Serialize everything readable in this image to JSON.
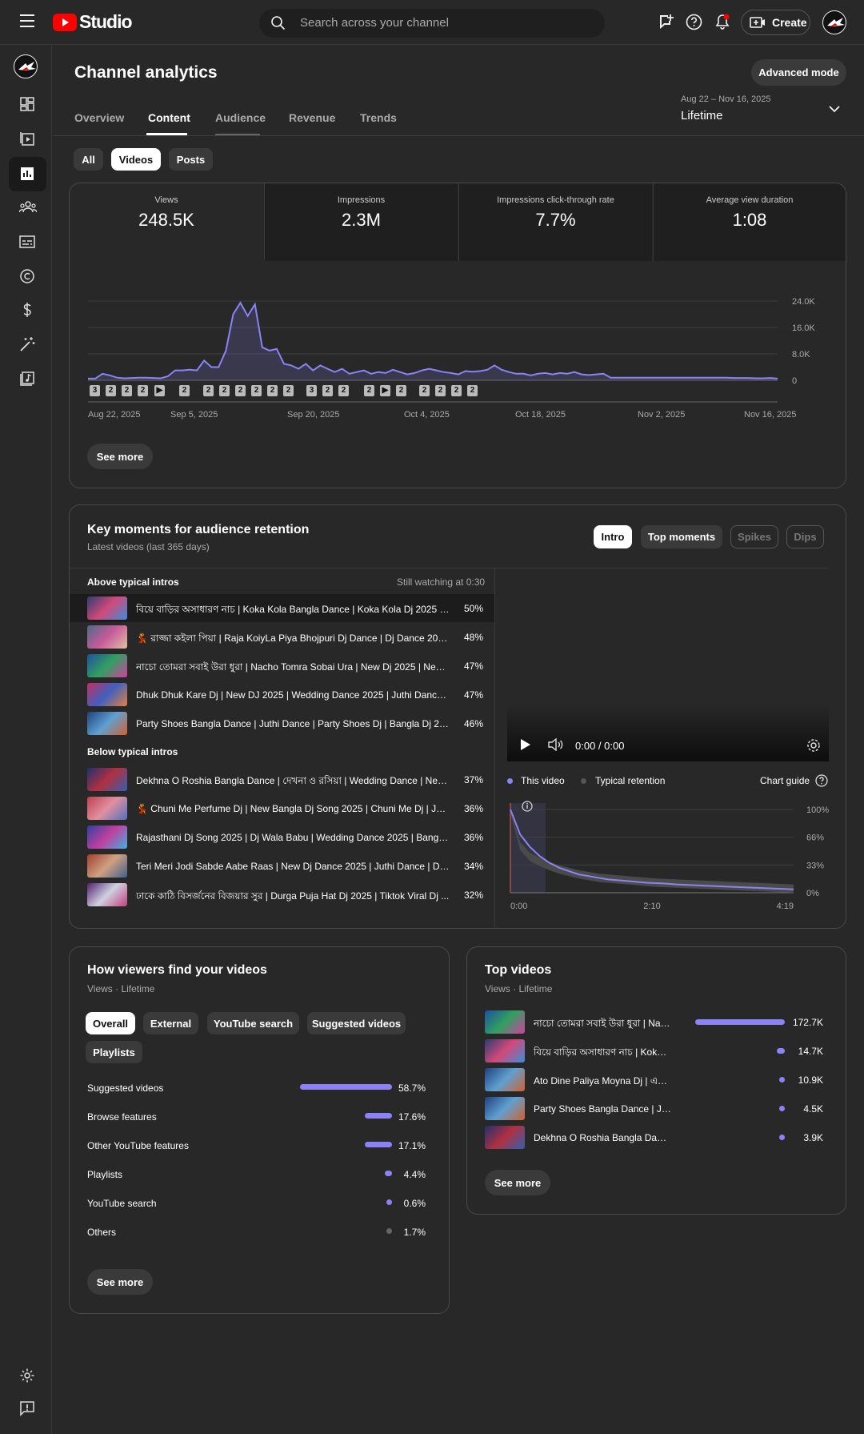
{
  "app": {
    "brand": "Studio",
    "search_placeholder": "Search across your channel",
    "create_label": "Create"
  },
  "header": {
    "title": "Channel analytics",
    "advanced_mode": "Advanced mode",
    "tabs": [
      "Overview",
      "Content",
      "Audience",
      "Revenue",
      "Trends"
    ],
    "date_range": "Aug 22 – Nov 16, 2025",
    "date_selected": "Lifetime"
  },
  "filters": [
    "All",
    "Videos",
    "Posts"
  ],
  "metrics": [
    {
      "label": "Views",
      "value": "248.5K"
    },
    {
      "label": "Impressions",
      "value": "2.3M"
    },
    {
      "label": "Impressions click-through rate",
      "value": "7.7%"
    },
    {
      "label": "Average view duration",
      "value": "1:08"
    }
  ],
  "chart_data": [
    {
      "type": "area",
      "title": "Views",
      "y_ticks": [
        "24.0K",
        "16.0K",
        "8.0K",
        "0"
      ],
      "ylim": [
        0,
        24000
      ],
      "x_tick_labels": [
        "Aug 22, 2025",
        "Sep 5, 2025",
        "Sep 20, 2025",
        "Oct 4, 2025",
        "Oct 18, 2025",
        "Nov 2, 2025",
        "Nov 16, 2025"
      ],
      "values": [
        500,
        500,
        2000,
        1500,
        800,
        600,
        700,
        800,
        800,
        700,
        600,
        1200,
        3000,
        3000,
        3200,
        3000,
        6000,
        4000,
        4000,
        9000,
        20000,
        23500,
        19500,
        23000,
        10000,
        9000,
        9500,
        5000,
        4500,
        3500,
        5000,
        3000,
        4500,
        3500,
        2500,
        3500,
        2000,
        2500,
        3000,
        2000,
        2500,
        2200,
        3200,
        2500,
        1800,
        2200,
        3000,
        3500,
        3000,
        2500,
        2200,
        1800,
        2800,
        2600,
        2800,
        3200,
        4500,
        3200,
        2500,
        2000,
        2000,
        1500,
        2000,
        2200,
        1800,
        2200,
        2000,
        2500,
        1800,
        1600,
        1800,
        2000,
        800,
        800,
        800,
        800,
        800,
        800,
        800,
        800,
        800,
        800,
        800,
        800,
        800,
        800,
        800,
        800,
        800,
        700,
        700,
        700,
        600,
        600,
        700,
        500
      ],
      "video_markers": [
        "3",
        "2",
        "2",
        "2",
        "▶",
        "2",
        "2",
        "2",
        "2",
        "2",
        "2",
        "2",
        "3",
        "2",
        "2",
        "2",
        "▶",
        "2",
        "2",
        "2",
        "2",
        "2"
      ],
      "grid": true
    },
    {
      "type": "line",
      "title": "Audience retention",
      "y_ticks": [
        "100%",
        "66%",
        "33%",
        "0%"
      ],
      "x_tick_labels": [
        "0:00",
        "2:10",
        "4:19"
      ],
      "ylim": [
        0,
        100
      ],
      "series": [
        {
          "name": "This video",
          "color": "#8b83f5",
          "values": [
            100,
            70,
            55,
            44,
            36,
            30,
            26,
            22,
            20,
            18,
            16,
            15,
            14,
            13,
            12,
            11.5,
            11,
            10,
            9.5,
            9,
            8.5,
            8,
            7.5,
            7,
            6.5,
            6,
            5.5,
            5,
            4.5,
            4
          ]
        },
        {
          "name": "Typical retention",
          "color": "#555555",
          "values": [
            100,
            55,
            42,
            36,
            31,
            27,
            24,
            21,
            19,
            17,
            16,
            15,
            14,
            13,
            12,
            11,
            10.5,
            10,
            9.5,
            9,
            8.5,
            8,
            7.5,
            7,
            6.5,
            6,
            5.5,
            5,
            4.5,
            4
          ]
        }
      ]
    }
  ],
  "see_more": "See more",
  "key_moments": {
    "title": "Key moments for audience retention",
    "subtitle": "Latest videos (last 365 days)",
    "tabs": [
      "Intro",
      "Top moments",
      "Spikes",
      "Dips"
    ],
    "above_label": "Above typical intros",
    "still_watching": "Still watching at 0:30",
    "below_label": "Below typical intros",
    "above": [
      {
        "title": "বিয়ে বাড়ির অসাধারণ নাচ | Koka Kola Bangla Dance | Koka Kola Dj 2025 | B...",
        "pct": "50%"
      },
      {
        "title": "💃 রাজ্জা কইলা পিয়া | Raja KoiyLa Piya Bhojpuri Dj Dance | Dj Dance 2025 | ...",
        "pct": "48%"
      },
      {
        "title": "নাচো তোমরা সবাই উরা ধুরা | Nacho Tomra Sobai Ura | New Dj 2025 | New ...",
        "pct": "47%"
      },
      {
        "title": "Dhuk Dhuk Kare Dj | New DJ 2025 | Wedding Dance 2025 | Juthi Dance | B...",
        "pct": "47%"
      },
      {
        "title": "Party Shoes Bangla Dance | Juthi Dance | Party Shoes Dj | Bangla Dj 2025 ...",
        "pct": "46%"
      }
    ],
    "below": [
      {
        "title": "Dekhna O Roshia Bangla Dance | দেখনা ও রসিয়া | Wedding Dance | New Dj...",
        "pct": "37%"
      },
      {
        "title": "💃 Chuni Me Perfume Dj | New Bangla Dj Song 2025 | Chuni Me Dj | Juthi ...",
        "pct": "36%"
      },
      {
        "title": "Rajasthani Dj Song 2025 | Dj Wala Babu | Wedding Dance 2025 | Bangla N...",
        "pct": "36%"
      },
      {
        "title": "Teri Meri Jodi Sabde Aabe Raas | New Dj Dance 2025 | Juthi Dance | Dj Da...",
        "pct": "34%"
      },
      {
        "title": "ঢাকে কাঠি বিসর্জনের বিজয়ার সুর | Durga Puja Hat Dj 2025 | Tiktok Viral Dj ...",
        "pct": "32%"
      }
    ],
    "player_time": "0:00 / 0:00",
    "legend_this": "This video",
    "legend_typical": "Typical retention",
    "chart_guide": "Chart guide"
  },
  "find": {
    "title": "How viewers find your videos",
    "subtitle": "Views · Lifetime",
    "chips": [
      "Overall",
      "External",
      "YouTube search",
      "Suggested videos",
      "Playlists"
    ],
    "sources": [
      {
        "name": "Suggested videos",
        "pct": "58.7%",
        "value": 58.7
      },
      {
        "name": "Browse features",
        "pct": "17.6%",
        "value": 17.6
      },
      {
        "name": "Other YouTube features",
        "pct": "17.1%",
        "value": 17.1
      },
      {
        "name": "Playlists",
        "pct": "4.4%",
        "value": 4.4
      },
      {
        "name": "YouTube search",
        "pct": "0.6%",
        "value": 0.6
      },
      {
        "name": "Others",
        "pct": "1.7%",
        "value": 1.7
      }
    ]
  },
  "top": {
    "title": "Top videos",
    "subtitle": "Views · Lifetime",
    "videos": [
      {
        "title": "নাচো তোমরা সবাই উরা ধুরা | Nac...",
        "views": "172.7K",
        "value": 172.7
      },
      {
        "title": "বিয়ে বাড়ির অসাধারণ নাচ | Koka ...",
        "views": "14.7K",
        "value": 14.7
      },
      {
        "title": "Ato Dine Paliya Moyna Dj | এত...",
        "views": "10.9K",
        "value": 10.9
      },
      {
        "title": "Party Shoes Bangla Dance | Jut...",
        "views": "4.5K",
        "value": 4.5
      },
      {
        "title": "Dekhna O Roshia Bangla Dance...",
        "views": "3.9K",
        "value": 3.9
      }
    ]
  },
  "colors": {
    "accent": "#8b83f5",
    "brand_red": "#ff0000",
    "bg": "#282828"
  }
}
